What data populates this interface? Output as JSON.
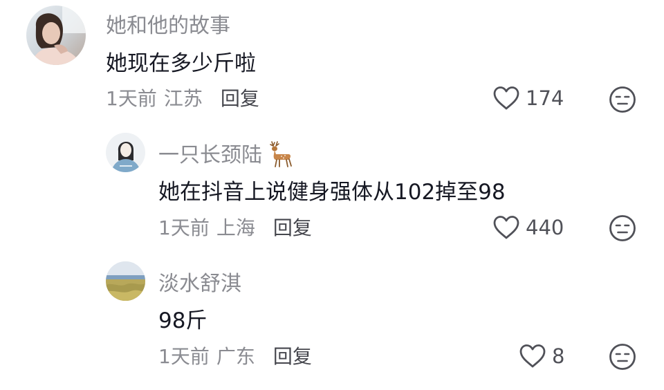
{
  "comments": [
    {
      "username": "她和他的故事",
      "content": "她现在多少斤啦",
      "time": "1天前",
      "location": "江苏",
      "reply_label": "回复",
      "like_count": "174",
      "avatar_icon": "user-avatar-photo"
    },
    {
      "username": "一只长颈陆",
      "username_emoji": "deer-emoji",
      "content": "她在抖音上说健身强体从102掉至98",
      "time": "1天前",
      "location": "上海",
      "reply_label": "回复",
      "like_count": "440",
      "avatar_icon": "user-avatar-drawing"
    },
    {
      "username": "淡水舒淇",
      "content": "98斤",
      "time": "1天前",
      "location": "广东",
      "reply_label": "回复",
      "like_count": "8",
      "avatar_icon": "user-avatar-landscape"
    }
  ],
  "colors": {
    "username": "#8a8b91",
    "content": "#161823",
    "reply": "#45464d",
    "icon": "#505158"
  }
}
